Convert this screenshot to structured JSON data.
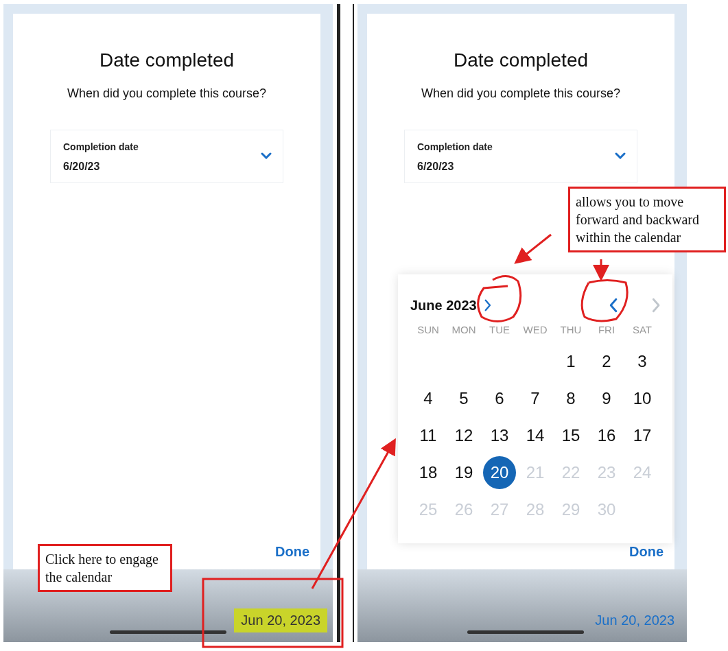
{
  "screens": [
    {
      "title": "Date completed",
      "question": "When did you complete this course?",
      "field": {
        "label": "Completion date",
        "value": "6/20/23"
      },
      "done": "Done",
      "date_button": {
        "label": "Jun 20, 2023",
        "highlighted": true
      }
    },
    {
      "title": "Date completed",
      "question": "When did you complete this course?",
      "field": {
        "label": "Completion date",
        "value": "6/20/23"
      },
      "calendar": {
        "month": "June 2023",
        "prev_disabled": false,
        "next_disabled": true,
        "weekdays": [
          "SUN",
          "MON",
          "TUE",
          "WED",
          "THU",
          "FRI",
          "SAT"
        ],
        "weeks": [
          [
            {
              "label": "1",
              "selected": false,
              "disabled": false
            },
            {
              "label": "2",
              "selected": false,
              "disabled": false
            },
            {
              "label": "3",
              "selected": false,
              "disabled": false
            }
          ],
          [
            {
              "label": "4",
              "selected": false,
              "disabled": false
            },
            {
              "label": "5",
              "selected": false,
              "disabled": false
            },
            {
              "label": "6",
              "selected": false,
              "disabled": false
            },
            {
              "label": "7",
              "selected": false,
              "disabled": false
            },
            {
              "label": "8",
              "selected": false,
              "disabled": false
            },
            {
              "label": "9",
              "selected": false,
              "disabled": false
            },
            {
              "label": "10",
              "selected": false,
              "disabled": false
            }
          ],
          [
            {
              "label": "11",
              "selected": false,
              "disabled": false
            },
            {
              "label": "12",
              "selected": false,
              "disabled": false
            },
            {
              "label": "13",
              "selected": false,
              "disabled": false
            },
            {
              "label": "14",
              "selected": false,
              "disabled": false
            },
            {
              "label": "15",
              "selected": false,
              "disabled": false
            },
            {
              "label": "16",
              "selected": false,
              "disabled": false
            },
            {
              "label": "17",
              "selected": false,
              "disabled": false
            }
          ],
          [
            {
              "label": "18",
              "selected": false,
              "disabled": false
            },
            {
              "label": "19",
              "selected": false,
              "disabled": false
            },
            {
              "label": "20",
              "selected": true,
              "disabled": false
            },
            {
              "label": "21",
              "selected": false,
              "disabled": true
            },
            {
              "label": "22",
              "selected": false,
              "disabled": true
            },
            {
              "label": "23",
              "selected": false,
              "disabled": true
            },
            {
              "label": "24",
              "selected": false,
              "disabled": true
            }
          ],
          [
            {
              "label": "25",
              "selected": false,
              "disabled": true
            },
            {
              "label": "26",
              "selected": false,
              "disabled": true
            },
            {
              "label": "27",
              "selected": false,
              "disabled": true
            },
            {
              "label": "28",
              "selected": false,
              "disabled": true
            },
            {
              "label": "29",
              "selected": false,
              "disabled": true
            },
            {
              "label": "30",
              "selected": false,
              "disabled": true
            }
          ]
        ]
      },
      "done": "Done",
      "date_button": {
        "label": "Jun 20, 2023",
        "highlighted": false
      }
    }
  ],
  "notes": [
    {
      "text": "Click here to engage the calendar"
    },
    {
      "text": "allows you to move forward and backward within the calendar"
    }
  ]
}
